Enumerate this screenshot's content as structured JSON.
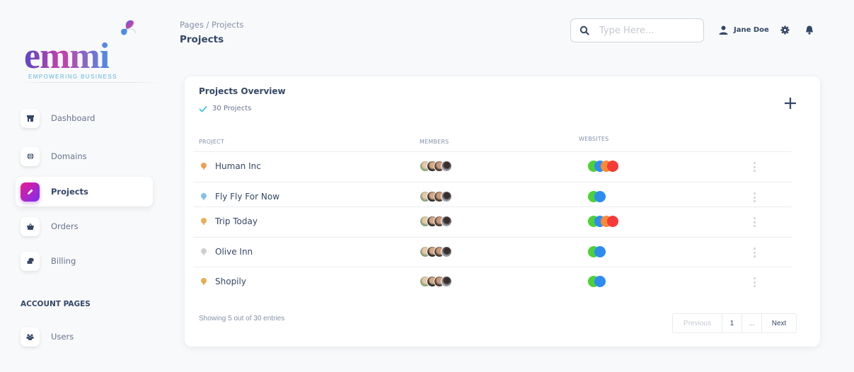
{
  "brand": {
    "name": "emmi",
    "tagline": "EMPOWERING BUSINESS"
  },
  "sidebar": {
    "items": [
      {
        "label": "Dashboard",
        "icon": "shop-icon",
        "active": false
      },
      {
        "label": "Domains",
        "icon": "globe-icon",
        "active": false
      },
      {
        "label": "Projects",
        "icon": "pencil-icon",
        "active": true
      },
      {
        "label": "Orders",
        "icon": "basket-icon",
        "active": false
      },
      {
        "label": "Billing",
        "icon": "coins-icon",
        "active": false
      }
    ],
    "section_title": "ACCOUNT PAGES",
    "account_items": [
      {
        "label": "Users",
        "icon": "users-icon",
        "active": false
      }
    ]
  },
  "header": {
    "breadcrumb": "Pages / Projects",
    "title": "Projects",
    "search_placeholder": "Type Here...",
    "search_value": "",
    "user_name": "Jane Doe"
  },
  "card": {
    "title": "Projects Overview",
    "count_label": "30 Projects",
    "columns": [
      "PROJECT",
      "MEMBERS",
      "WEBSITES"
    ],
    "rows": [
      {
        "name": "Human Inc",
        "icon": "tree-icon",
        "icon_color": "#e8913a",
        "members": 4,
        "websites": [
          "#4cd137",
          "#2e8cf0",
          "#ff8a34",
          "#f53a3a"
        ]
      },
      {
        "name": "Fly Fly For Now",
        "icon": "bird-icon",
        "icon_color": "#6fb7e8",
        "members": 4,
        "websites": [
          "#4cd137",
          "#2e8cf0"
        ]
      },
      {
        "name": "Trip Today",
        "icon": "signpost-icon",
        "icon_color": "#e8a23a",
        "members": 4,
        "websites": [
          "#4cd137",
          "#2e8cf0",
          "#ff8a34",
          "#f53a3a"
        ]
      },
      {
        "name": "Olive Inn",
        "icon": "olive-icon",
        "icon_color": "#c8c8c8",
        "members": 4,
        "websites": [
          "#4cd137",
          "#2e8cf0"
        ]
      },
      {
        "name": "Shopily",
        "icon": "cart-icon",
        "icon_color": "#e0a030",
        "members": 4,
        "websites": [
          "#4cd137",
          "#2e8cf0"
        ]
      }
    ],
    "footer_text": "Showing 5 out of 30 entries",
    "pagination": {
      "previous": "Previous",
      "pages": [
        "1",
        "..."
      ],
      "next": "Next"
    }
  },
  "colors": {
    "accent_gradient_start": "#ec1a8c",
    "accent_gradient_end": "#7b2ff7",
    "text_primary": "#344767",
    "text_secondary": "#67748e",
    "check": "#17c1e8"
  }
}
